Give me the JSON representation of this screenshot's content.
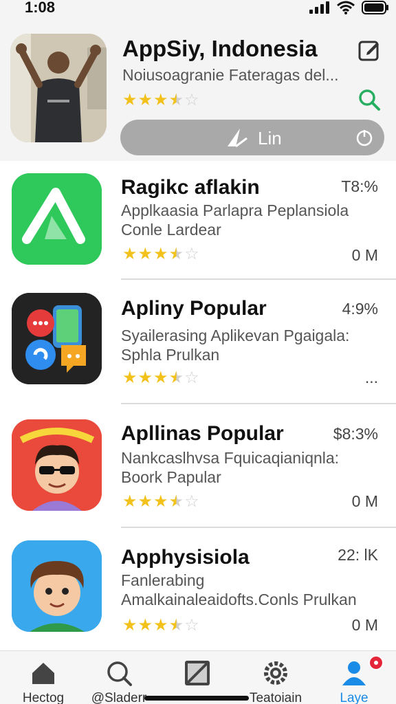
{
  "status": {
    "time": "1:08"
  },
  "header": {
    "title": "AppSiy, Indonesia",
    "subtitle": "Noiusoagranie Fateragas del...",
    "rating": 3.5,
    "link_label": "Lin"
  },
  "apps": [
    {
      "name": "Ragikc aflakin",
      "description": "Applkaasia Parlapra Peplansiola Conle Lardear",
      "meta": "T8:%",
      "size": "0 M",
      "rating": 3.5,
      "icon": "green-a-icon"
    },
    {
      "name": "Apliny Popular",
      "description": "Syailerasing Aplikevan Pgaigala: Sphla Prulkan",
      "meta": "4:9%",
      "size": "...",
      "rating": 3.5,
      "icon": "messaging-apps-icon"
    },
    {
      "name": "Apllinas Popular",
      "description": "Nankcaslhvsa Fquicaqianiqnla: Boork Papular",
      "meta": "$8:3%",
      "size": "0 M",
      "rating": 3.5,
      "icon": "cartoon-sunglasses-icon"
    },
    {
      "name": "Apphysisiola",
      "description": "Fanlerabing Amalkainaleaidofts.Conls Prulkan",
      "meta": "22: lK",
      "size": "0 M",
      "rating": 3.5,
      "icon": "cartoon-boy-icon"
    }
  ],
  "tabs": [
    {
      "label": "Hectog",
      "icon": "home-icon"
    },
    {
      "label": "@Sladerr",
      "icon": "search-icon"
    },
    {
      "label": "",
      "icon": "media-icon"
    },
    {
      "label": "Teatoiain",
      "icon": "settings-icon"
    },
    {
      "label": "Laye",
      "icon": "profile-icon",
      "active": true
    }
  ],
  "colors": {
    "accent": "#1a8be6",
    "star": "#f3c11b",
    "search": "#27ae60",
    "badge": "#e5253a"
  }
}
